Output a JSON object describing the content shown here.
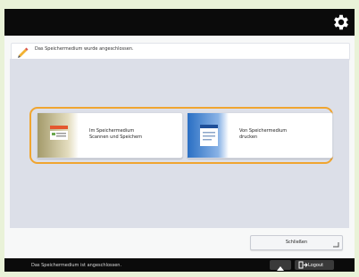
{
  "info": {
    "message": "Das Speichermedium wurde angeschlossen."
  },
  "options": [
    {
      "label": "Im Speichermedium\nScannen  und Speichern",
      "icon": "scan-to-media-icon"
    },
    {
      "label": "Von Speichermedium\ndrucken",
      "icon": "print-from-media-icon"
    }
  ],
  "buttons": {
    "close_label": "Schließen",
    "logout_label": "Logout"
  },
  "status": {
    "text": "Das Speichermedium ist angeschlossen."
  },
  "colors": {
    "selection_border": "#f0a530",
    "top_bar": "#0b0b0b",
    "content_bg": "#dcdfe8"
  }
}
